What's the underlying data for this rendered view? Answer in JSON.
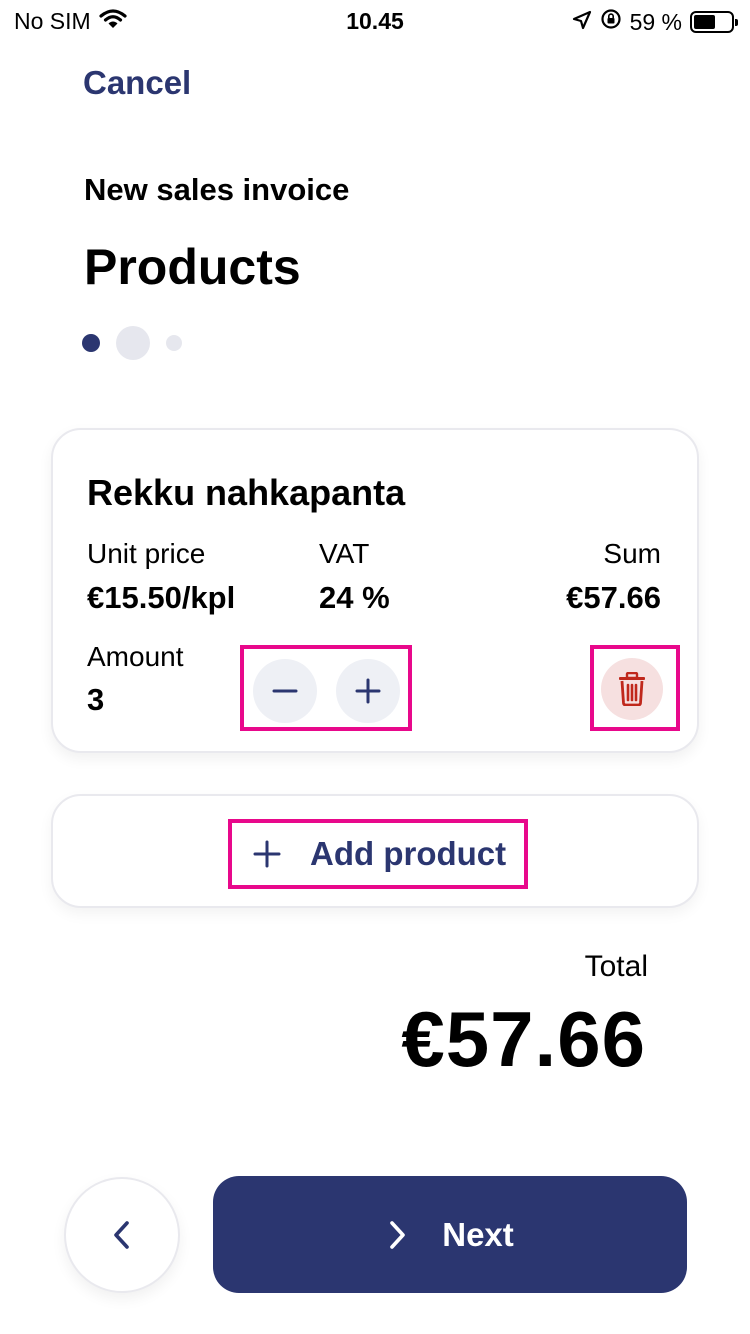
{
  "status_bar": {
    "carrier": "No SIM",
    "time": "10.45",
    "battery": "59 %",
    "battery_level": 0.59,
    "icons": [
      "wifi-icon",
      "location-arrow-icon",
      "orientation-lock-icon",
      "battery-icon"
    ]
  },
  "header": {
    "cancel_label": "Cancel",
    "subtitle": "New sales invoice",
    "title": "Products"
  },
  "pagination": {
    "steps": 3,
    "current": 1
  },
  "product": {
    "name": "Rekku nahkapanta",
    "unit_price_label": "Unit price",
    "unit_price_value": "€15.50/kpl",
    "vat_label": "VAT",
    "vat_value": "24 %",
    "sum_label": "Sum",
    "sum_value": "€57.66",
    "amount_label": "Amount",
    "amount_value": "3"
  },
  "add_product": {
    "label": "Add product"
  },
  "total": {
    "label": "Total",
    "value": "€57.66"
  },
  "footer": {
    "next_label": "Next"
  },
  "colors": {
    "accent": "#2b3670",
    "highlight": "#e8088b",
    "delete": "#c0281c",
    "delete_bg": "#f6e0e0",
    "stepper_bg": "#eef0f5"
  }
}
